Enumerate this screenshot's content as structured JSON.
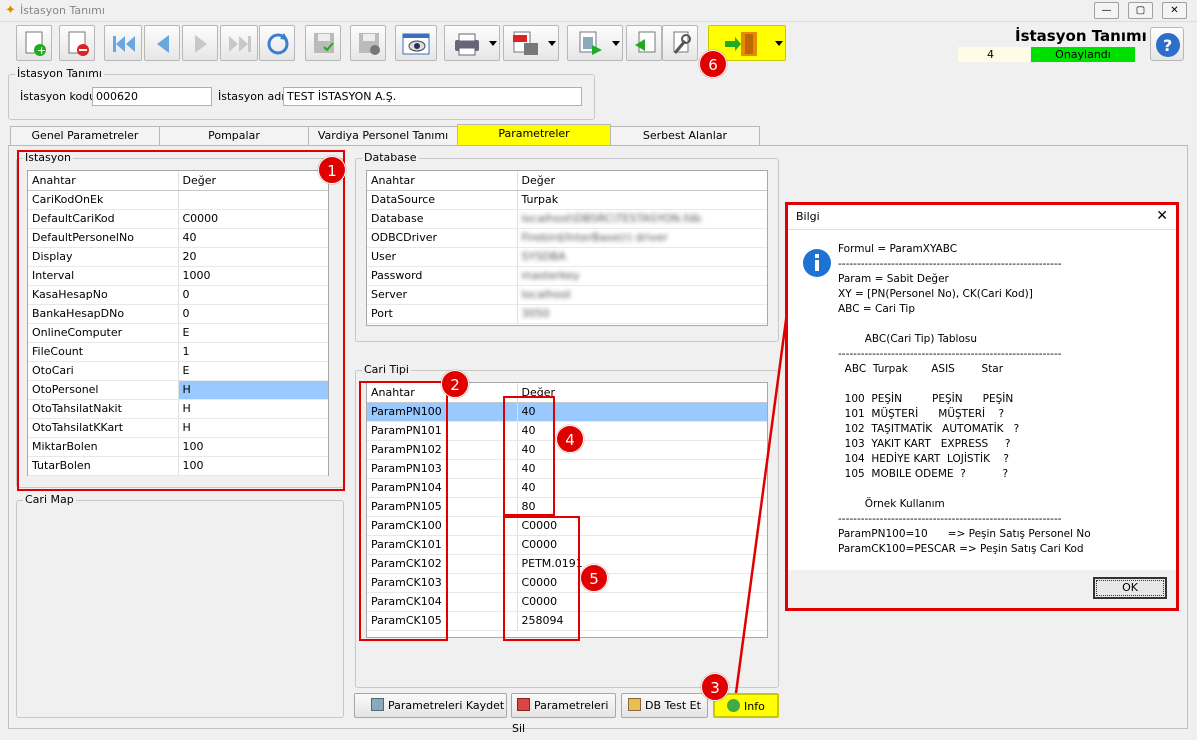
{
  "window": {
    "title": "İstasyon Tanımı",
    "min": "—",
    "max": "▢",
    "close": "✕"
  },
  "header": {
    "title": "İstasyon Tanımı",
    "count": "4",
    "status": "Onaylandı"
  },
  "station": {
    "group_label": "İstasyon Tanımı",
    "code_label": "İstasyon kodu",
    "code_value": "000620",
    "name_label": "İstasyon adı",
    "name_value": "TEST İSTASYON A.Ş."
  },
  "tabs": [
    {
      "label": "Genel Parametreler"
    },
    {
      "label": "Pompalar"
    },
    {
      "label": "Vardiya Personel Tanımı"
    },
    {
      "label": "Parametreler"
    },
    {
      "label": "Serbest Alanlar"
    }
  ],
  "istasyon_grid": {
    "label": "İstasyon",
    "col_key": "Anahtar",
    "col_val": "Değer",
    "rows": [
      [
        "CariKodOnEk",
        ""
      ],
      [
        "DefaultCariKod",
        "C0000"
      ],
      [
        "DefaultPersonelNo",
        "40"
      ],
      [
        "Display",
        "20"
      ],
      [
        "Interval",
        "1000"
      ],
      [
        "KasaHesapNo",
        "0"
      ],
      [
        "BankaHesapDNo",
        "0"
      ],
      [
        "OnlineComputer",
        "E"
      ],
      [
        "FileCount",
        "1"
      ],
      [
        "OtoCari",
        "E"
      ],
      [
        "OtoPersonel",
        "H"
      ],
      [
        "OtoTahsilatNakit",
        "H"
      ],
      [
        "OtoTahsilatKKart",
        "H"
      ],
      [
        "MiktarBolen",
        "100"
      ],
      [
        "TutarBolen",
        "100"
      ]
    ]
  },
  "cari_map": {
    "label": "Cari Map"
  },
  "database_grid": {
    "label": "Database",
    "col_key": "Anahtar",
    "col_val": "Değer",
    "rows": [
      [
        "DataSource",
        "Turpak"
      ],
      [
        "Database",
        "localhost\\DBSRC\\TESTASYON.fdb"
      ],
      [
        "ODBCDriver",
        "Firebird/InterBase(r) driver"
      ],
      [
        "User",
        "SYSDBA"
      ],
      [
        "Password",
        "masterkey"
      ],
      [
        "Server",
        "localhost"
      ],
      [
        "Port",
        "3050"
      ]
    ]
  },
  "cari_tipi_grid": {
    "label": "Cari Tipi",
    "col_key": "Anahtar",
    "col_val": "Değer",
    "rows": [
      [
        "ParamPN100",
        "40"
      ],
      [
        "ParamPN101",
        "40"
      ],
      [
        "ParamPN102",
        "40"
      ],
      [
        "ParamPN103",
        "40"
      ],
      [
        "ParamPN104",
        "40"
      ],
      [
        "ParamPN105",
        "80"
      ],
      [
        "ParamCK100",
        "C0000"
      ],
      [
        "ParamCK101",
        "C0000"
      ],
      [
        "ParamCK102",
        "PETM.0191"
      ],
      [
        "ParamCK103",
        "C0000"
      ],
      [
        "ParamCK104",
        "C0000"
      ],
      [
        "ParamCK105",
        "258094"
      ]
    ]
  },
  "buttons": {
    "save": "Parametreleri Kaydet",
    "delete": "Parametreleri Sil",
    "dbtest": "DB Test Et",
    "info": "Info"
  },
  "badges": [
    "1",
    "2",
    "3",
    "4",
    "5",
    "6"
  ],
  "dialog": {
    "title": "Bilgi",
    "close": "✕",
    "ok": "OK",
    "text": "Formul = ParamXYABC\n-----------------------------------------------------------\nParam = Sabit Değer\nXY = [PN(Personel No), CK(Cari Kod)]\nABC = Cari Tip\n\n        ABC(Cari Tip) Tablosu\n-----------------------------------------------------------\n  ABC  Turpak       ASIS        Star\n\n  100  PEŞİN         PEŞİN      PEŞİN\n  101  MÜŞTERİ      MÜŞTERİ    ?\n  102  TAŞITMATİK   AUTOMATİK   ?\n  103  YAKIT KART   EXPRESS     ?\n  104  HEDİYE KART  LOJİSTİK    ?\n  105  MOBILE ODEME  ?           ?\n\n        Örnek Kullanım\n-----------------------------------------------------------\nParamPN100=10      => Peşin Satış Personel No\nParamCK100=PESCAR => Peşin Satış Cari Kod"
  },
  "colors": {
    "highlight": "#ffff00",
    "status_green": "#00e000",
    "annotation_red": "#e00000",
    "selection": "#99c9ff"
  }
}
